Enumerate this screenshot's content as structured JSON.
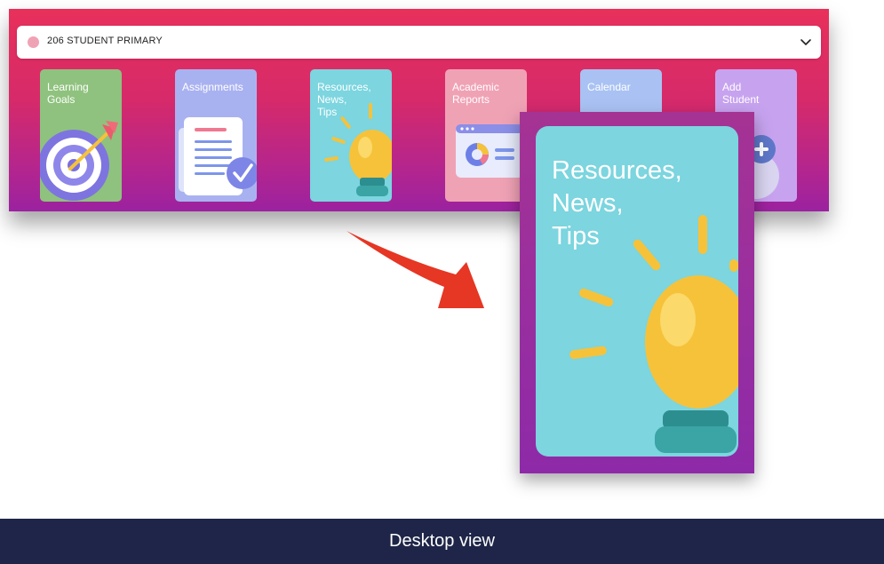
{
  "selector": {
    "value": "206 STUDENT PRIMARY",
    "dot_color": "#f0a2b5",
    "icon": "chevron-down-icon"
  },
  "tiles": [
    {
      "label": "Learning\nGoals",
      "color": "#8fc27e",
      "icon": "target-arrow-icon"
    },
    {
      "label": "Assignments",
      "color": "#a9b2f0",
      "icon": "document-check-icon"
    },
    {
      "label": "Resources,\nNews,\nTips",
      "color": "#7cd5df",
      "icon": "lightbulb-icon"
    },
    {
      "label": "Academic\nReports",
      "color": "#f0a2b5",
      "icon": "report-chart-icon"
    },
    {
      "label": "Calendar",
      "color": "#a9c2f3",
      "icon": "calendar-icon"
    },
    {
      "label": "Add\nStudent",
      "color": "#c7a3ef",
      "icon": "add-student-icon"
    }
  ],
  "zoom": {
    "label": "Resources,\nNews,\nTips",
    "icon": "lightbulb-icon"
  },
  "arrow": {
    "color": "#e63624",
    "icon": "curved-arrow-icon"
  },
  "footer": {
    "caption": "Desktop view",
    "background": "#1e2548"
  }
}
